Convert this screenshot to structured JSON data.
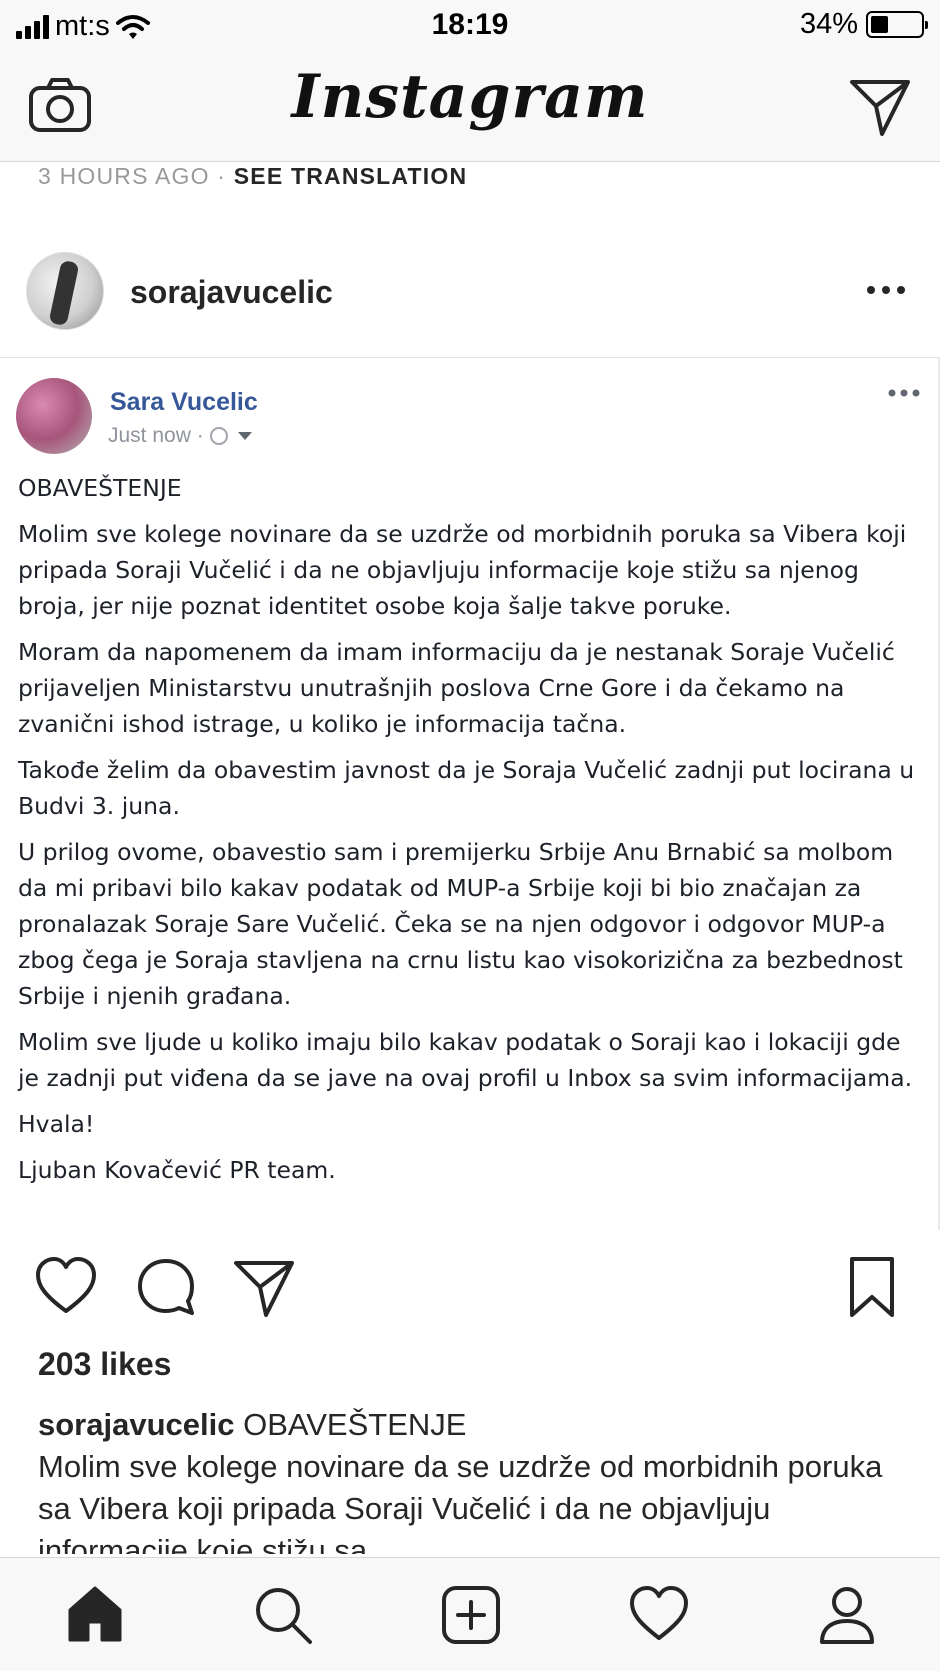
{
  "status_bar": {
    "carrier": "mt:s",
    "time": "18:19",
    "battery_percent": "34%",
    "battery_level": 0.34
  },
  "nav": {
    "logo": "Instagram",
    "camera_icon": "camera-icon",
    "direct_icon": "paper-plane-icon"
  },
  "previous_post": {
    "time_ago": "3 HOURS AGO",
    "separator": " · ",
    "see_translation": "SEE TRANSLATION"
  },
  "post": {
    "username": "sorajavucelic",
    "image": {
      "author": "Sara Vucelic",
      "time": "Just now ·",
      "paragraphs": [
        "OBAVEŠTENJE",
        "Molim sve kolege novinare da se uzdrže od morbidnih poruka sa Vibera koji pripada Soraji Vučelić i da ne objavljuju informacije koje stižu sa njenog broja, jer nije poznat identitet osobe koja šalje takve poruke.",
        "Moram da napomenem da imam informaciju da je nestanak Soraje Vučelić prijaveljen Ministarstvu unutrašnjih poslova Crne Gore i da čekamo na zvanični ishod istrage, u koliko je informacija tačna.",
        "Takođe želim da obavestim javnost da je Soraja Vučelić zadnji put locirana u Budvi 3. juna.",
        "U prilog ovome, obavestio sam i premijerku Srbije Anu Brnabić sa molbom da mi pribavi bilo kakav podatak od MUP-a Srbije koji bi bio značajan za pronalazak Soraje Sare Vučelić. Čeka se na njen odgovor i odgovor MUP-a zbog čega je Soraja stavljena na crnu listu kao visokorizična za bezbednost Srbije i njenih građana.",
        "Molim sve ljude u koliko imaju bilo kakav podatak o Soraji kao i lokaciji gde je zadnji put viđena da se jave na ovaj profil u Inbox sa svim informacijama.",
        "Hvala!",
        "Ljuban Kovačević PR team."
      ]
    },
    "likes": "203 likes",
    "caption_user": "sorajavucelic",
    "caption_title": "OBAVEŠTENJE",
    "caption_text": "Molim sve kolege novinare da se uzdrže od morbidnih poruka sa Vibera koji pripada Soraji Vučelić i da ne objavljuju informacije koje stižu sa"
  },
  "tabs": [
    "home-icon",
    "search-icon",
    "add-post-icon",
    "heart-icon",
    "profile-icon"
  ]
}
